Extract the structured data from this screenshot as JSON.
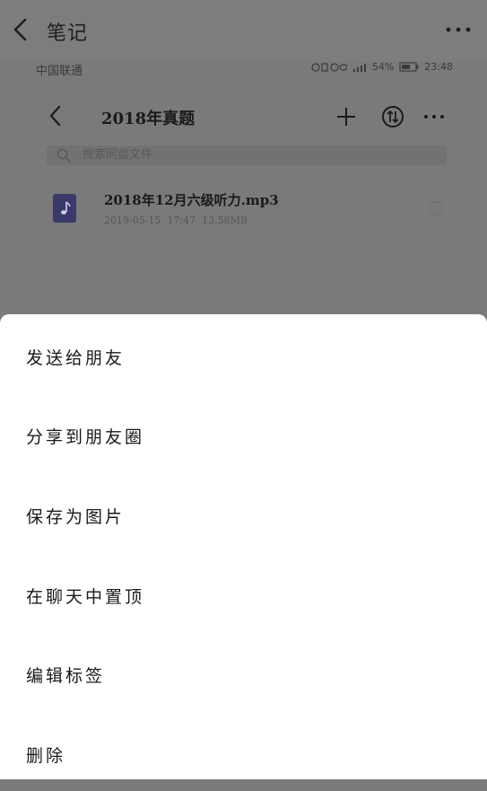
{
  "top_bar": {
    "title": "笔记",
    "back_icon": "chevron-left-icon",
    "more_icon": "more-horizontal-icon"
  },
  "embedded_screenshot": {
    "status_bar": {
      "carrier": "中国联通",
      "battery": "54%",
      "time": "23:48"
    },
    "header": {
      "title": "2018年真题"
    },
    "search": {
      "placeholder": "搜索网盘文件"
    },
    "file": {
      "name": "2018年12月六级听力.mp3",
      "date": "2019-05-15",
      "time": "17:47",
      "size": "13.58MB"
    }
  },
  "menu": {
    "items": [
      {
        "label": "发送给朋友"
      },
      {
        "label": "分享到朋友圈"
      },
      {
        "label": "保存为图片"
      },
      {
        "label": "在聊天中置顶"
      },
      {
        "label": "编辑标签"
      },
      {
        "label": "删除"
      }
    ]
  },
  "colors": {
    "overlay": "#7a7a7a",
    "sheet_background": "#ffffff",
    "text": "#1a1a1a"
  }
}
